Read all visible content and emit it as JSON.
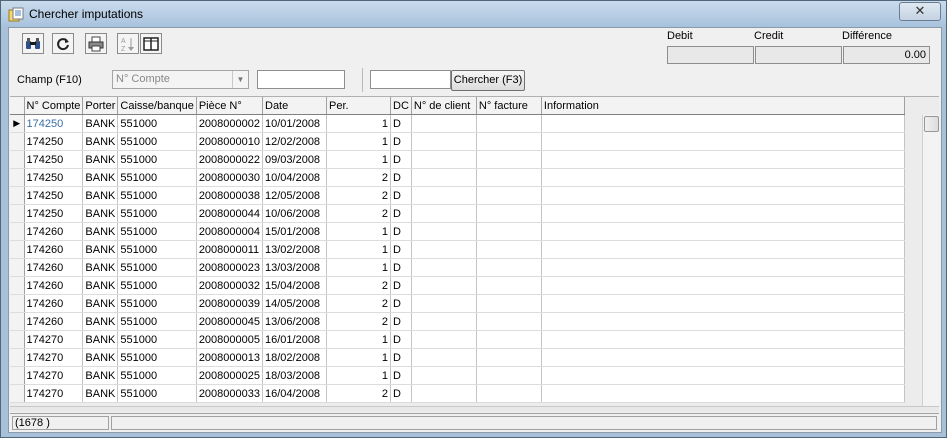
{
  "window": {
    "title": "Chercher imputations",
    "close_label": "✕"
  },
  "summary": {
    "debit_label": "Debit",
    "credit_label": "Credit",
    "difference_label": "Différence",
    "debit_value": "",
    "credit_value": "",
    "difference_value": "0.00"
  },
  "filter": {
    "champ_label": "Champ (F10)",
    "field_selected": "N° Compte",
    "value": "",
    "search_value": "",
    "search_button": "Chercher (F3)"
  },
  "toolbar": {
    "icons": [
      "binoculars-icon",
      "refresh-icon",
      "print-icon",
      "sort-az-icon",
      "columns-icon"
    ]
  },
  "table": {
    "columns": [
      "N° Compte",
      "Porter",
      "Caisse/banque",
      "Pièce N°",
      "Date",
      "Per.",
      "DC",
      "N° de client",
      "N° facture",
      "Information"
    ],
    "rows": [
      [
        "174250",
        "BANK",
        "551000",
        "2008000002",
        "10/01/2008",
        "1",
        "D",
        "",
        "",
        ""
      ],
      [
        "174250",
        "BANK",
        "551000",
        "2008000010",
        "12/02/2008",
        "1",
        "D",
        "",
        "",
        ""
      ],
      [
        "174250",
        "BANK",
        "551000",
        "2008000022",
        "09/03/2008",
        "1",
        "D",
        "",
        "",
        ""
      ],
      [
        "174250",
        "BANK",
        "551000",
        "2008000030",
        "10/04/2008",
        "2",
        "D",
        "",
        "",
        ""
      ],
      [
        "174250",
        "BANK",
        "551000",
        "2008000038",
        "12/05/2008",
        "2",
        "D",
        "",
        "",
        ""
      ],
      [
        "174250",
        "BANK",
        "551000",
        "2008000044",
        "10/06/2008",
        "2",
        "D",
        "",
        "",
        ""
      ],
      [
        "174260",
        "BANK",
        "551000",
        "2008000004",
        "15/01/2008",
        "1",
        "D",
        "",
        "",
        ""
      ],
      [
        "174260",
        "BANK",
        "551000",
        "2008000011",
        "13/02/2008",
        "1",
        "D",
        "",
        "",
        ""
      ],
      [
        "174260",
        "BANK",
        "551000",
        "2008000023",
        "13/03/2008",
        "1",
        "D",
        "",
        "",
        ""
      ],
      [
        "174260",
        "BANK",
        "551000",
        "2008000032",
        "15/04/2008",
        "2",
        "D",
        "",
        "",
        ""
      ],
      [
        "174260",
        "BANK",
        "551000",
        "2008000039",
        "14/05/2008",
        "2",
        "D",
        "",
        "",
        ""
      ],
      [
        "174260",
        "BANK",
        "551000",
        "2008000045",
        "13/06/2008",
        "2",
        "D",
        "",
        "",
        ""
      ],
      [
        "174270",
        "BANK",
        "551000",
        "2008000005",
        "16/01/2008",
        "1",
        "D",
        "",
        "",
        ""
      ],
      [
        "174270",
        "BANK",
        "551000",
        "2008000013",
        "18/02/2008",
        "1",
        "D",
        "",
        "",
        ""
      ],
      [
        "174270",
        "BANK",
        "551000",
        "2008000025",
        "18/03/2008",
        "1",
        "D",
        "",
        "",
        ""
      ],
      [
        "174270",
        "BANK",
        "551000",
        "2008000033",
        "16/04/2008",
        "2",
        "D",
        "",
        "",
        ""
      ]
    ]
  },
  "status": {
    "count": "(1678 )"
  }
}
